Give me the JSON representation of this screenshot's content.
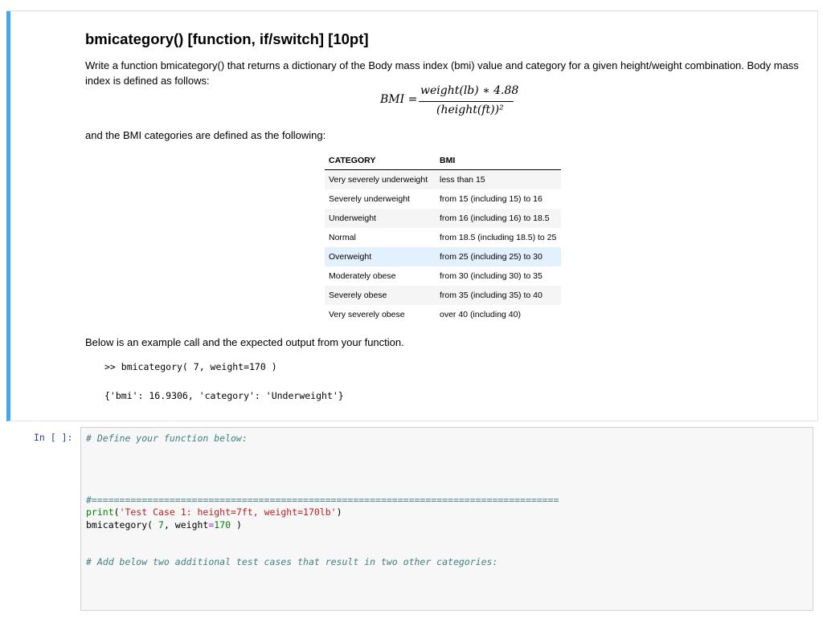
{
  "markdown": {
    "title": "bmicategory() [function, if/switch] [10pt]",
    "intro": "Write a function bmicategory() that returns a dictionary of the Body mass index (bmi) value and category for a given height/weight combination. Body mass index is defined as follows:",
    "formula": {
      "lhs": "BMI =",
      "numerator": "weight(lb) ∗ 4.88",
      "denominator": "(height(ft))²"
    },
    "categories_intro": "and the BMI categories are defined as the following:",
    "table": {
      "headers": [
        "CATEGORY",
        "BMI"
      ],
      "rows": [
        [
          "Very severely underweight",
          "less than 15"
        ],
        [
          "Severely underweight",
          "from 15 (including 15) to 16"
        ],
        [
          "Underweight",
          "from 16 (including 16) to 18.5"
        ],
        [
          "Normal",
          "from 18.5 (including 18.5) to 25"
        ],
        [
          "Overweight",
          "from 25 (including 25) to 30"
        ],
        [
          "Moderately obese",
          "from 30 (including 30) to 35"
        ],
        [
          "Severely obese",
          "from 35 (including 35) to 40"
        ],
        [
          "Very severely obese",
          "over 40 (including 40)"
        ]
      ]
    },
    "example_intro": "Below is an example call and the expected output from your function.",
    "example_call": ">> bmicategory( 7, weight=170 )",
    "example_output": "{'bmi': 16.9306, 'category': 'Underweight'}"
  },
  "code_cell": {
    "prompt": "In [ ]:",
    "comment_define": "# Define your function below:",
    "separator": "#====================================================================================",
    "print_fn": "print",
    "print_open": "(",
    "print_string": "'Test Case 1: height=7ft, weight=170lb'",
    "print_close": ")",
    "call_name": "bmicategory( ",
    "call_arg1": "7",
    "call_mid": ", weight",
    "call_eq": "=",
    "call_arg2": "170",
    "call_end": " )",
    "comment_add": "# Add below two additional test cases that result in two other categories:"
  }
}
